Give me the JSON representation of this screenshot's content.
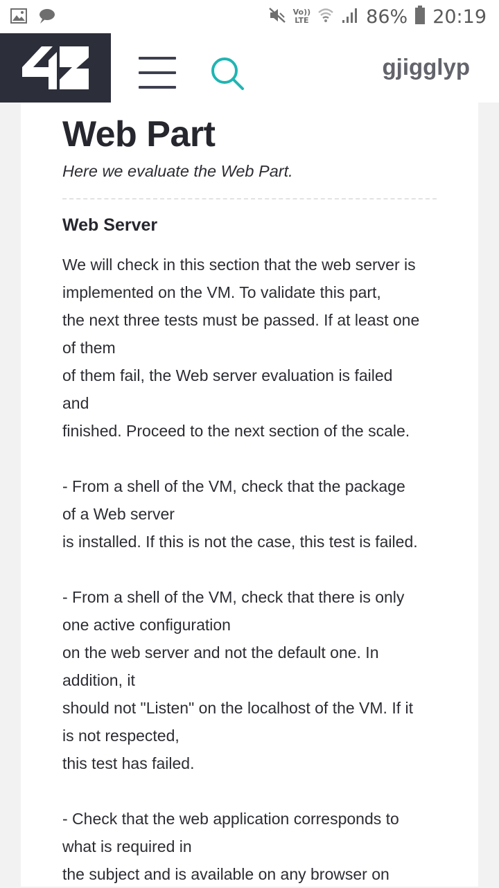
{
  "status_bar": {
    "left_icons": [
      "image-icon",
      "message-icon"
    ],
    "volte_top": "Vo))",
    "volte_bottom": "LTE",
    "battery": "86%",
    "time": "20:19"
  },
  "header": {
    "logo_text": "42",
    "username": "gjigglyp",
    "colors": {
      "logo_bg": "#2c2f3a",
      "search_accent": "#1fb5b3"
    }
  },
  "main": {
    "title": "Web Part",
    "subtitle": "Here we evaluate the Web Part.",
    "section": {
      "title": "Web Server",
      "body": "We will check in this section that the web server is\nimplemented on the VM. To validate this part,\nthe next three tests must be passed. If at least one\nof them\nof them fail, the Web server evaluation is failed\nand\nfinished. Proceed to the next section of the scale.\n\n- From a shell of the VM, check that the package\nof a Web server\nis installed. If this is not the case, this test is failed.\n\n- From a shell of the VM, check that there is only\none active configuration\non the web server and not the default one. In\naddition, it\nshould not \"Listen\" on the localhost of the VM. If it\nis not respected,\nthis test has failed.\n\n- Check that the web application corresponds to\nwhat is required in\nthe subject and is available on any browser on"
    }
  }
}
